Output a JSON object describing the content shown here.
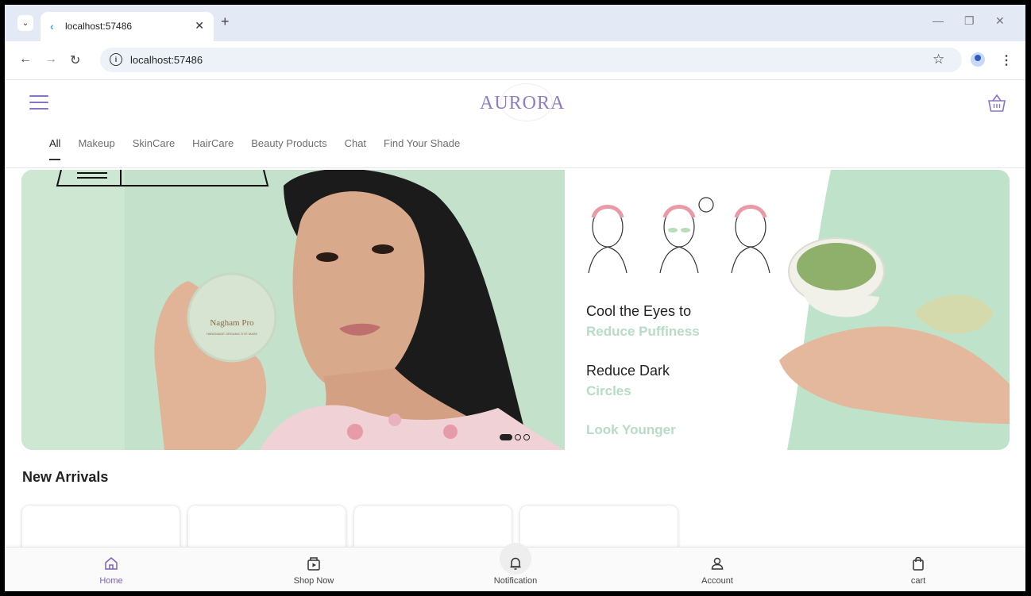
{
  "browser": {
    "tab_title": "localhost:57486",
    "url": "localhost:57486"
  },
  "app": {
    "logo": "AURORA",
    "brand_color": "#8f7dc6",
    "categories": [
      "All",
      "Makeup",
      "SkinCare",
      "HairCare",
      "Beauty Products",
      "Chat",
      "Find Your Shade"
    ],
    "active_category": "All"
  },
  "banner": {
    "left_slide": {
      "product_brand": "Nagham Pro",
      "product_subtitle": "HANDMADE ORGANIC EYE MASK",
      "background_color": "#c3e1cb"
    },
    "right_slide": {
      "line1": "Cool the Eyes to",
      "line1_accent": "Reduce Puffiness",
      "line2": "Reduce Dark",
      "line2_accent": "Circles",
      "line3_accent": "Look Younger",
      "accent_color": "#b6ddc4"
    },
    "carousel": {
      "count": 3,
      "active_index": 0
    }
  },
  "new_arrivals": {
    "title": "New Arrivals",
    "card_count": 4
  },
  "bottom_nav": {
    "items": [
      {
        "label": "Home",
        "icon": "home-icon",
        "active": true
      },
      {
        "label": "Shop Now",
        "icon": "shop-now-icon",
        "active": false
      },
      {
        "label": "Notification",
        "icon": "bell-icon",
        "active": false
      },
      {
        "label": "Account",
        "icon": "account-icon",
        "active": false
      },
      {
        "label": "cart",
        "icon": "cart-bag-icon",
        "active": false
      }
    ]
  }
}
